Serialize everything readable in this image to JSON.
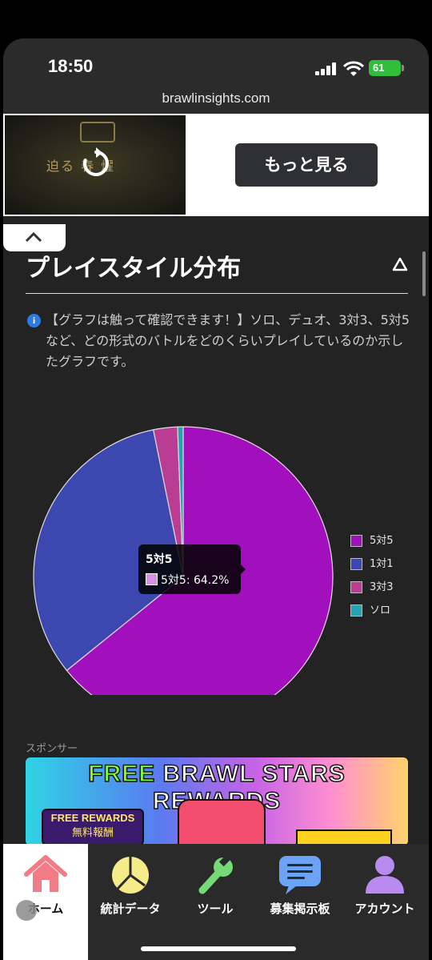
{
  "status_bar": {
    "time": "18:50",
    "battery": "61"
  },
  "browser": {
    "url": "brawlinsights.com"
  },
  "ad": {
    "button_label": "もっと見る"
  },
  "section": {
    "title": "プレイスタイル分布",
    "description": "【グラフは触って確認できます！】ソロ、デュオ、3対3、5対5など、どの形式のバトルをどのくらいプレイしているのか示したグラフです。"
  },
  "chart_data": {
    "type": "pie",
    "categories": [
      "5対5",
      "1対1",
      "3対3",
      "ソロ"
    ],
    "values": [
      64.2,
      32.6,
      2.6,
      0.6
    ],
    "colors": [
      "#a20fbd",
      "#3c47b0",
      "#bb3c93",
      "#23a5b5"
    ],
    "legend_position": "right",
    "tooltip": {
      "title": "5対5",
      "label": "5対5: 64.2%"
    }
  },
  "sponsor": {
    "label": "スポンサー",
    "headline_free": "FREE",
    "headline_rest": " BRAWL STARS REWARDS",
    "badge_line1": "FREE REWARDS",
    "badge_line2": "無料報酬"
  },
  "nav": {
    "items": [
      {
        "label": "ホーム",
        "icon": "home-icon",
        "color": "#f07d86"
      },
      {
        "label": "統計データ",
        "icon": "pie-chart-icon",
        "color": "#f5eb88"
      },
      {
        "label": "ツール",
        "icon": "wrench-icon",
        "color": "#74d977"
      },
      {
        "label": "募集掲示板",
        "icon": "message-board-icon",
        "color": "#6ba3f5"
      },
      {
        "label": "アカウント",
        "icon": "user-icon",
        "color": "#b98bf0"
      }
    ]
  }
}
